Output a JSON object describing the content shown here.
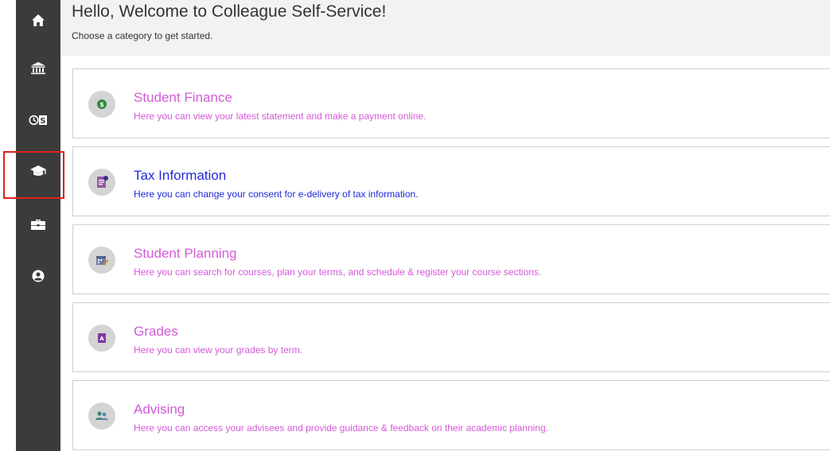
{
  "header": {
    "title": "Hello, Welcome to Colleague Self-Service!",
    "subtitle": "Choose a category to get started."
  },
  "sidebar": {
    "items": [
      {
        "name": "home",
        "icon": "home-icon"
      },
      {
        "name": "bank",
        "icon": "bank-icon"
      },
      {
        "name": "time-money",
        "icon": "clock-dollar-icon"
      },
      {
        "name": "academics",
        "icon": "graduation-cap-icon",
        "highlighted": true
      },
      {
        "name": "employment",
        "icon": "briefcase-icon"
      },
      {
        "name": "profile",
        "icon": "user-circle-icon"
      }
    ]
  },
  "cards": [
    {
      "title": "Student Finance",
      "description": "Here you can view your latest statement and make a payment online.",
      "icon": "dollar-coin-icon",
      "color": "#d45ad9"
    },
    {
      "title": "Tax Information",
      "description": "Here you can change your consent for e-delivery of tax information.",
      "icon": "tax-document-icon",
      "color": "#1f2ad6"
    },
    {
      "title": "Student Planning",
      "description": "Here you can search for courses, plan your terms, and schedule & register your course sections.",
      "icon": "calendar-edit-icon",
      "color": "#d45ad9"
    },
    {
      "title": "Grades",
      "description": "Here you can view your grades by term.",
      "icon": "grade-book-icon",
      "color": "#d45ad9"
    },
    {
      "title": "Advising",
      "description": "Here you can access your advisees and provide guidance & feedback on their academic planning.",
      "icon": "advisees-icon",
      "color": "#d45ad9"
    }
  ],
  "colors": {
    "sidebar": "#3b3b3b",
    "header_bg": "#f2f2f2",
    "highlight": "#e0201f",
    "link_pink": "#d45ad9",
    "link_blue": "#1f2ad6"
  }
}
